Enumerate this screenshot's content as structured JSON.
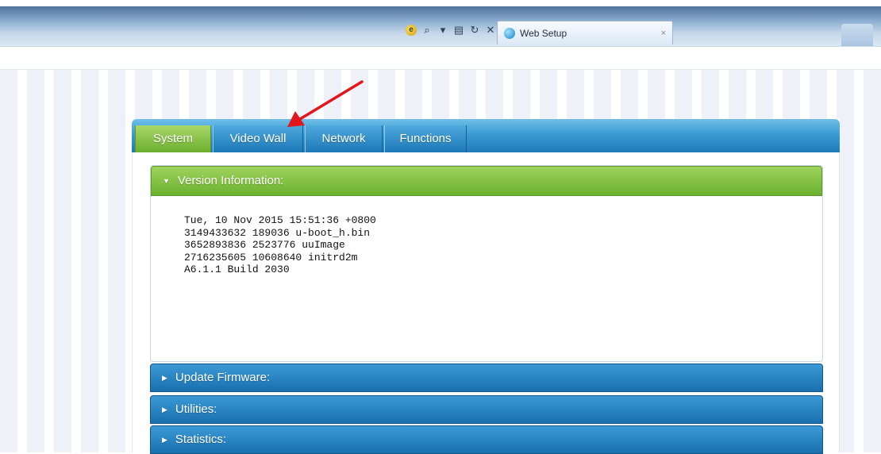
{
  "browser": {
    "tab_title": "Web Setup",
    "tab_close": "×",
    "tools": {
      "search_icon": "⌕",
      "dropdown_icon": "▾",
      "compat_icon": "compatibility-view-icon",
      "page_icon": "▤",
      "refresh_icon": "↻",
      "stop_icon": "✕"
    }
  },
  "app": {
    "tabs": [
      {
        "label": "System",
        "active": true
      },
      {
        "label": "Video Wall",
        "active": false
      },
      {
        "label": "Network",
        "active": false
      },
      {
        "label": "Functions",
        "active": false
      }
    ],
    "sections": {
      "version": {
        "title": "Version Information:",
        "expanded": true,
        "lines": [
          "Tue, 10 Nov 2015 15:51:36 +0800",
          "3149433632 189036 u-boot_h.bin",
          "3652893836 2523776 uuImage",
          "2716235605 10608640 initrd2m",
          "A6.1.1 Build 2030"
        ]
      },
      "update_firmware": {
        "title": "Update Firmware:",
        "expanded": false
      },
      "utilities": {
        "title": "Utilities:",
        "expanded": false
      },
      "statistics": {
        "title": "Statistics:",
        "expanded": false
      }
    }
  },
  "colors": {
    "active_green": "#6cae2c",
    "tab_blue": "#1c78b7",
    "annotation_red": "#e3161b"
  }
}
